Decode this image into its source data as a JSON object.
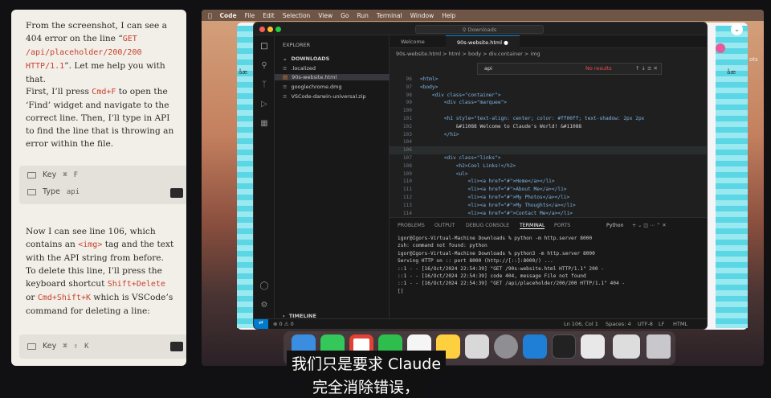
{
  "chat": {
    "para1_a": "From the screenshot, I can see a 404 error on the line “",
    "para1_code": "GET /api/placeholder/200/200 HTTP/1.1",
    "para1_b": "”. Let me help you with that.",
    "para2_a": "First, I’ll press ",
    "para2_code": "Cmd+F",
    "para2_b": " to open the ‘Find’ widget and navigate to the correct line. Then, I’ll type in API to find the line that is throwing an error within the file.",
    "tool1": {
      "row1_label": "Key",
      "row1_k1": "⌘",
      "row1_k2": "F",
      "row2_label": "Type",
      "row2_value": "api"
    },
    "para3_a": "Now I can see line 106, which contains an ",
    "para3_code1": "<img>",
    "para3_b": " tag and the text with the API string from before. To delete this line, I’ll press the keyboard shortcut ",
    "para3_code2": "Shift+Delete",
    "para3_c": " or ",
    "para3_code3": "Cmd+Shift+K",
    "para3_d": " which is VSCode’s command for deleting a line:",
    "tool2": {
      "label": "Key",
      "k1": "⌘",
      "k2": "⇧",
      "k3": "K"
    }
  },
  "menubar": {
    "app": "Code",
    "items": [
      "File",
      "Edit",
      "Selection",
      "View",
      "Go",
      "Run",
      "Terminal",
      "Window",
      "Help"
    ]
  },
  "browser": {
    "left_tag": "åæ",
    "right_tag": "åæ",
    "right_ots": "ots"
  },
  "vscode": {
    "search_placeholder": "Downloads",
    "explorer_title": "EXPLORER",
    "folder": "DOWNLOADS",
    "files": [
      ".localized",
      "90s-website.html",
      "googlechrome.dmg",
      "VSCode-darwin-universal.zip"
    ],
    "timeline": "TIMELINE",
    "tabs": [
      "Welcome",
      "90s-website.html"
    ],
    "crumbs": "90s-website.html > html > body > div.container > img",
    "find": {
      "value": "api",
      "result": "No results"
    },
    "code": [
      {
        "n": "96",
        "html": "<html>"
      },
      {
        "n": "97",
        "html": "<body>"
      },
      {
        "n": "98",
        "html": "    <div class=\"container\">"
      },
      {
        "n": "99",
        "html": "        <div class=\"marquee\">"
      },
      {
        "n": "100",
        "html": ""
      },
      {
        "n": "101",
        "html": "        <h1 style=\"text-align: center; color: #ff00ff; text-shadow: 2px 2px"
      },
      {
        "n": "102",
        "html": "            &#11088 Welcome to Claude's World! &#11088"
      },
      {
        "n": "103",
        "html": "        </h1>"
      },
      {
        "n": "104",
        "html": ""
      },
      {
        "n": "106",
        "html": ""
      },
      {
        "n": "107",
        "html": "        <div class=\"links\">"
      },
      {
        "n": "108",
        "html": "            <h2>Cool Links!</h2>"
      },
      {
        "n": "109",
        "html": "            <ul>"
      },
      {
        "n": "110",
        "html": "                <li><a href=\"#\">Home</a></li>"
      },
      {
        "n": "111",
        "html": "                <li><a href=\"#\">About Me</a></li>"
      },
      {
        "n": "112",
        "html": "                <li><a href=\"#\">My Photos</a></li>"
      },
      {
        "n": "113",
        "html": "                <li><a href=\"#\">My Thoughts</a></li>"
      },
      {
        "n": "114",
        "html": "                <li><a href=\"#\">Contact Me</a></li>"
      }
    ],
    "panel_tabs": [
      "PROBLEMS",
      "OUTPUT",
      "DEBUG CONSOLE",
      "TERMINAL",
      "PORTS"
    ],
    "shell": "Python",
    "terminal": [
      "igor@Igors-Virtual-Machine Downloads % python -m http.server 8000",
      "zsh: command not found: python",
      "igor@Igors-Virtual-Machine Downloads % python3 -m http.server 8000",
      "Serving HTTP on :: port 8000 (http://[::]:8000/) ...",
      "::1 - - [16/Oct/2024 22:54:39] \"GET /90s-website.html HTTP/1.1\" 200 -",
      "::1 - - [16/Oct/2024 22:54:39] code 404, message File not found",
      "::1 - - [16/Oct/2024 22:54:39] \"GET /api/placeholder/200/200 HTTP/1.1\" 404 -",
      "[]"
    ],
    "status": {
      "left": "⊗ 0 ⚠ 0",
      "ln": "Ln 106, Col 1",
      "spaces": "Spaces: 4",
      "enc": "UTF-8",
      "eol": "LF",
      "lang": "HTML"
    }
  },
  "subtitles": {
    "line1": "我们只是要求 Claude",
    "line2": "完全消除错误，"
  },
  "colors": {
    "accent": "#007acc",
    "error": "#f14c4c",
    "chat_code": "#c7422e"
  }
}
